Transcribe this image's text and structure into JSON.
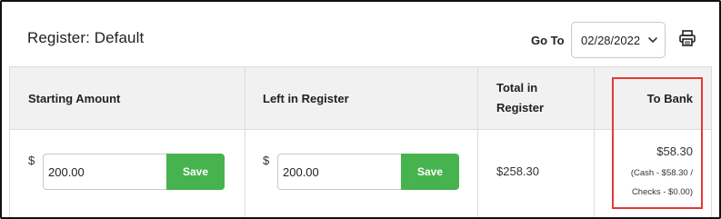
{
  "header": {
    "title": "Register: Default",
    "goto_label": "Go To",
    "date_value": "02/28/2022",
    "print_icon": "printer-icon"
  },
  "table": {
    "columns": [
      {
        "label": "Starting Amount"
      },
      {
        "label": "Left in Register"
      },
      {
        "label": "Total in Register"
      },
      {
        "label": "To Bank"
      }
    ],
    "row": {
      "starting": {
        "currency": "$",
        "value": "200.00",
        "save_label": "Save"
      },
      "left": {
        "currency": "$",
        "value": "200.00",
        "save_label": "Save"
      },
      "total": "$258.30",
      "to_bank": {
        "amount": "$58.30",
        "detail_line1": "(Cash - $58.30 /",
        "detail_line2": "Checks - $0.00)"
      }
    }
  },
  "colors": {
    "save_green": "#47b34e",
    "highlight_red": "#e53935",
    "header_bg": "#f1f1f1"
  }
}
